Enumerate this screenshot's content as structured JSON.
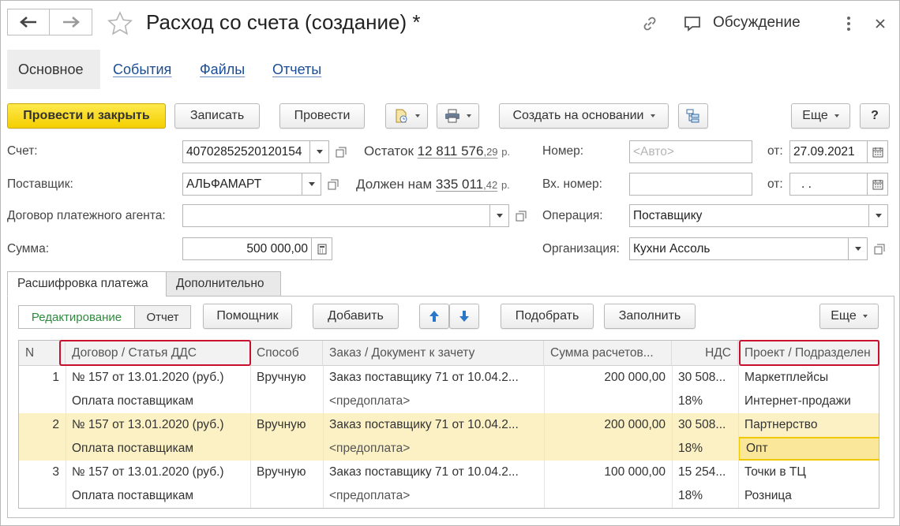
{
  "window": {
    "title": "Расход со счета (создание) *",
    "discussion_label": "Обсуждение"
  },
  "sections": [
    "Основное",
    "События",
    "Файлы",
    "Отчеты"
  ],
  "toolbar": {
    "post_and_close": "Провести и закрыть",
    "save": "Записать",
    "post": "Провести",
    "create_based_on": "Создать на основании",
    "more": "Еще",
    "help": "?"
  },
  "form": {
    "account_label": "Счет:",
    "account_value": "40702852520120154",
    "balance_label": "Остаток",
    "balance_int": "12 811 576",
    "balance_dec": ",29",
    "balance_unit": "р.",
    "number_label": "Номер:",
    "number_placeholder": "<Авто>",
    "date_label": "от:",
    "date_value": "27.09.2021",
    "supplier_label": "Поставщик:",
    "supplier_value": "АЛЬФАМАРТ",
    "debt_label": "Должен нам",
    "debt_int": "335 011",
    "debt_dec": ",42",
    "debt_unit": "р.",
    "incoming_number_label": "Вх. номер:",
    "incoming_date_label": "от:",
    "incoming_date_value": " .  .",
    "agent_contract_label": "Договор платежного агента:",
    "operation_label": "Операция:",
    "operation_value": "Поставщику",
    "amount_label": "Сумма:",
    "amount_value": "500 000,00",
    "organization_label": "Организация:",
    "organization_value": "Кухни Ассоль"
  },
  "inner_tabs": [
    "Расшифровка платежа",
    "Дополнительно"
  ],
  "table_toolbar": {
    "edit_mode": "Редактирование",
    "report_mode": "Отчет",
    "assistant": "Помощник",
    "add": "Добавить",
    "pick": "Подобрать",
    "fill": "Заполнить",
    "more": "Еще"
  },
  "table": {
    "columns": [
      "N",
      "Договор / Статья ДДС",
      "Способ",
      "Заказ / Документ к зачету",
      "Сумма расчетов...",
      "НДС",
      "Проект / Подразделен"
    ],
    "rows": [
      {
        "n": "1",
        "contract": "№ 157 от 13.01.2020 (руб.)",
        "article": "Оплата поставщикам",
        "method": "Вручную",
        "order": "Заказ поставщику 71 от 10.04.2...",
        "doc": "<предоплата>",
        "sum": "200 000,00",
        "vat_sum": "30 508...",
        "vat_rate": "18%",
        "project": "Маркетплейсы",
        "division": "Интернет-продажи"
      },
      {
        "n": "2",
        "contract": "№ 157 от 13.01.2020 (руб.)",
        "article": "Оплата поставщикам",
        "method": "Вручную",
        "order": "Заказ поставщику 71 от 10.04.2...",
        "doc": "<предоплата>",
        "sum": "200 000,00",
        "vat_sum": "30 508...",
        "vat_rate": "18%",
        "project": "Партнерство",
        "division": "Опт"
      },
      {
        "n": "3",
        "contract": "№ 157 от 13.01.2020 (руб.)",
        "article": "Оплата поставщикам",
        "method": "Вручную",
        "order": "Заказ поставщику 71 от 10.04.2...",
        "doc": "<предоплата>",
        "sum": "100 000,00",
        "vat_sum": "15 254...",
        "vat_rate": "18%",
        "project": "Точки в ТЦ",
        "division": "Розница"
      }
    ]
  },
  "colors": {
    "primary_button": "#f4cf00",
    "link": "#1c4e96",
    "selected_row": "#fbf1c4",
    "highlight_box": "#c8102e",
    "edit_mode_text": "#2e8b3d"
  }
}
